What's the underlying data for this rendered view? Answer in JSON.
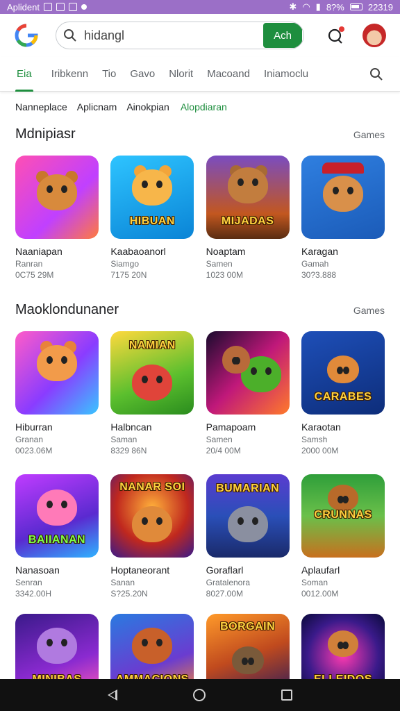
{
  "status_bar": {
    "left_text": "Aplident",
    "battery_text": "8?%",
    "time": "22319"
  },
  "search": {
    "value": "hidangl",
    "button_label": "Ach"
  },
  "tabs": [
    {
      "label": "Eia",
      "active": true
    },
    {
      "label": "Iribkenn",
      "active": false
    },
    {
      "label": "Tio",
      "active": false
    },
    {
      "label": "Gavo",
      "active": false
    },
    {
      "label": "Nlorit",
      "active": false
    },
    {
      "label": "Macoand",
      "active": false
    },
    {
      "label": "Iniamoclu",
      "active": false
    }
  ],
  "chips": [
    {
      "label": "Nanneplace"
    },
    {
      "label": "Aplicnam"
    },
    {
      "label": "Ainokpian"
    },
    {
      "label": "Alopdiaran"
    }
  ],
  "sections": [
    {
      "title": "Mdnipiasr",
      "more": "Games",
      "rows": [
        [
          {
            "name": "Naaniapan",
            "sub": "Ranran",
            "size": "0C75 29M"
          },
          {
            "name": "Kaabaoanorl",
            "sub": "Siamgo",
            "size": "7175 20N"
          },
          {
            "name": "Noaptam",
            "sub": "Samen",
            "size": "1023 00M"
          },
          {
            "name": "Karagan",
            "sub": "Gamah",
            "size": "30?3.888"
          }
        ]
      ]
    },
    {
      "title": "Maoklondunaner",
      "more": "Games",
      "rows": [
        [
          {
            "name": "Hiburran",
            "sub": "Granan",
            "size": "0023.06M"
          },
          {
            "name": "Halbncan",
            "sub": "Saman",
            "size": "8329 86N"
          },
          {
            "name": "Pamapoam",
            "sub": "Samen",
            "size": "20/4 00M"
          },
          {
            "name": "Karaotan",
            "sub": "Samsh",
            "size": "2000 00M"
          }
        ],
        [
          {
            "name": "Nanasoan",
            "sub": "Senran",
            "size": "3342.00H"
          },
          {
            "name": "Hoptaneorant",
            "sub": "Sanan",
            "size": "S?25.20N"
          },
          {
            "name": "Goraflarl",
            "sub": "Gratalenora",
            "size": "8027.00M"
          },
          {
            "name": "Aplaufarl",
            "sub": "Soman",
            "size": "0012.00M"
          }
        ],
        [
          {
            "name": "",
            "sub": "",
            "size": ""
          },
          {
            "name": "",
            "sub": "",
            "size": ""
          },
          {
            "name": "",
            "sub": "",
            "size": ""
          },
          {
            "name": "",
            "sub": "",
            "size": ""
          }
        ]
      ]
    }
  ],
  "thumb_text": {
    "s0": [
      "",
      "HIBUAN",
      "MIJADAS",
      ""
    ],
    "r1": [
      "",
      "NAMIAN",
      "",
      "CARABES"
    ],
    "r2": [
      "BAIIANAN",
      "NANAR SOI",
      "BUMARIAN",
      "CRUNNAS"
    ],
    "r3": [
      "MINIBAS",
      "AMMACIONS",
      "BORGAIN",
      "ELLEIDOS"
    ]
  },
  "icons": {
    "logo": "google-play-logo-icon",
    "search": "search-icon",
    "notification": "notification-bell-icon",
    "tab_search": "search-icon"
  },
  "colors": {
    "accent": "#1e8e3e",
    "status_bar": "#9b6fc7"
  }
}
